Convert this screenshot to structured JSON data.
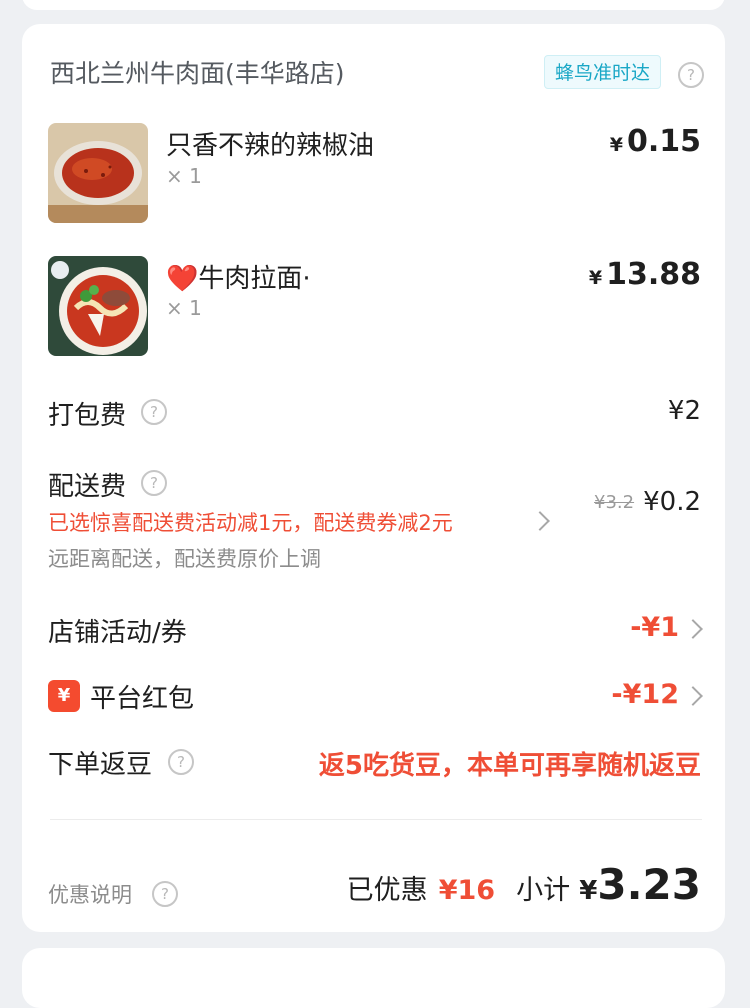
{
  "store": {
    "name": "西北兰州牛肉面(丰华路店)",
    "badge": "蜂鸟准时达"
  },
  "items": [
    {
      "name": "只香不辣的辣椒油",
      "qty": "× 1",
      "currency": "¥",
      "price": "0.15",
      "thumb_icon": "chili-oil-bowl"
    },
    {
      "name": "❤️牛肉拉面·",
      "qty": "× 1",
      "currency": "¥",
      "price": "13.88",
      "thumb_icon": "beef-noodle-bowl"
    }
  ],
  "packaging_fee": {
    "label": "打包费",
    "value": "¥2"
  },
  "delivery_fee": {
    "label": "配送费",
    "original": "¥3.2",
    "value": "¥0.2",
    "promo": "已选惊喜配送费活动减1元，配送费券减2元",
    "note": "远距离配送，配送费原价上调"
  },
  "store_discount": {
    "label": "店铺活动/券",
    "value": "-¥1"
  },
  "platform_hongbao": {
    "label": "平台红包",
    "icon_text": "¥",
    "value": "-¥12"
  },
  "rebate": {
    "label": "下单返豆",
    "text": "返5吃货豆，本单可再享随机返豆"
  },
  "footer": {
    "discount_note": "优惠说明",
    "saved_label": "已优惠",
    "saved_value": "¥16",
    "subtotal_label": "小计",
    "subtotal_currency": "¥",
    "subtotal_value": "3.23"
  },
  "help_icon": "?",
  "colors": {
    "accent_red": "#ef4e36",
    "badge_blue": "#19a7c6",
    "background": "#eef0f3"
  }
}
